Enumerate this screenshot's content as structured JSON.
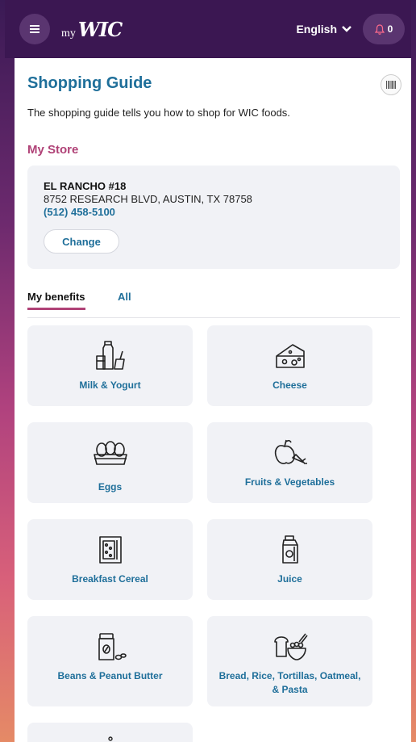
{
  "header": {
    "brand_my": "my",
    "brand_wic": "WIC",
    "language": "English",
    "notification_count": "0"
  },
  "page": {
    "title": "Shopping Guide",
    "description": "The shopping guide tells you how to shop for WIC foods."
  },
  "store": {
    "section_title": "My Store",
    "name": "EL RANCHO #18",
    "address": "8752 RESEARCH BLVD, AUSTIN, TX 78758",
    "phone": "(512) 458-5100",
    "change_label": "Change"
  },
  "tabs": [
    {
      "label": "My benefits",
      "active": true
    },
    {
      "label": "All",
      "active": false
    }
  ],
  "categories": [
    {
      "label": "Milk & Yogurt",
      "icon": "milk-yogurt-icon"
    },
    {
      "label": "Cheese",
      "icon": "cheese-icon"
    },
    {
      "label": "Eggs",
      "icon": "eggs-icon"
    },
    {
      "label": "Fruits & Vegetables",
      "icon": "fruits-vegetables-icon"
    },
    {
      "label": "Breakfast Cereal",
      "icon": "cereal-icon"
    },
    {
      "label": "Juice",
      "icon": "juice-icon"
    },
    {
      "label": "Beans & Peanut Butter",
      "icon": "beans-peanut-butter-icon"
    },
    {
      "label": "Bread, Rice, Tortillas, Oatmeal, & Pasta",
      "icon": "bread-grains-icon"
    }
  ],
  "colors": {
    "header_bg": "#3b1752",
    "accent_blue": "#1f6f9a",
    "accent_pink": "#b04277",
    "card_bg": "#f1f2f6"
  }
}
